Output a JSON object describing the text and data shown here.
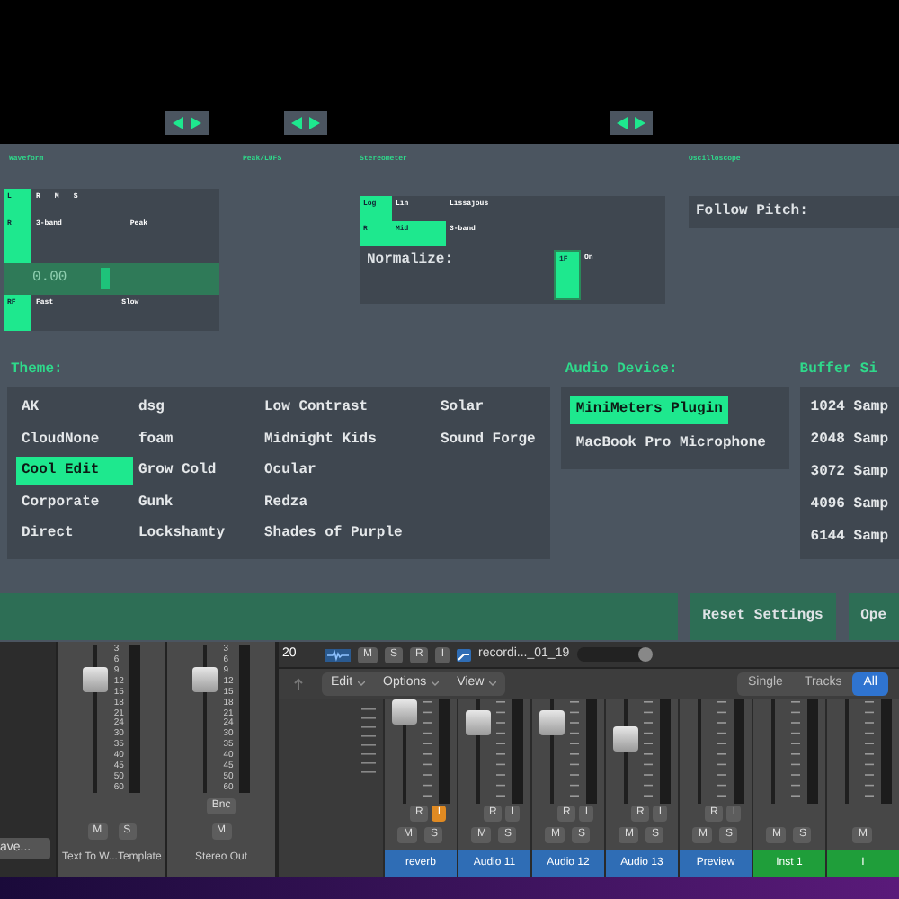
{
  "meters": {
    "waveform": {
      "title": "Waveform",
      "rows": [
        {
          "key": "L",
          "key_selected": true,
          "options": [
            "R",
            "M",
            "S"
          ]
        },
        {
          "key": "R",
          "key_selected": true,
          "options": [
            "3-band",
            "Peak"
          ]
        },
        {
          "key": "RF",
          "key_selected": true,
          "options": [
            "Fast",
            "Slow"
          ]
        }
      ],
      "slider": {
        "reading": "0.00",
        "level": 0.45
      }
    },
    "peak_lufs": {
      "title": "Peak/LUFS"
    },
    "stereometer": {
      "title": "Stereometer",
      "rows": [
        {
          "options": [
            {
              "label": "Log",
              "selected": true
            },
            {
              "label": "Lin",
              "selected": false
            },
            {
              "label": "Lissajous",
              "selected": false
            }
          ]
        },
        {
          "options": [
            {
              "label": "R",
              "selected": true
            },
            {
              "label": "Mid",
              "selected": true
            },
            {
              "label": "3-band",
              "selected": false
            }
          ]
        }
      ],
      "normalize": {
        "label": "Normalize:",
        "options": [
          {
            "label": "1F",
            "selected": true
          },
          {
            "label": "On",
            "selected": false
          }
        ]
      }
    },
    "oscilloscope": {
      "title": "Oscilloscope",
      "follow_pitch": "Follow Pitch:"
    }
  },
  "theme": {
    "title": "Theme:",
    "items": [
      {
        "label": "AK",
        "selected": false
      },
      {
        "label": "CloudNone",
        "selected": false
      },
      {
        "label": "Cool Edit",
        "selected": true
      },
      {
        "label": "Corporate",
        "selected": false
      },
      {
        "label": "Direct",
        "selected": false
      },
      {
        "label": "dsg",
        "selected": false
      },
      {
        "label": "foam",
        "selected": false
      },
      {
        "label": "Grow Cold",
        "selected": false
      },
      {
        "label": "Gunk",
        "selected": false
      },
      {
        "label": "Lockshamty",
        "selected": false
      },
      {
        "label": "Low Contrast",
        "selected": false
      },
      {
        "label": "Midnight Kids",
        "selected": false
      },
      {
        "label": "Ocular",
        "selected": false
      },
      {
        "label": "Redza",
        "selected": false
      },
      {
        "label": "Shades of Purple",
        "selected": false
      },
      {
        "label": "Solar",
        "selected": false
      },
      {
        "label": "Sound Forge",
        "selected": false
      }
    ]
  },
  "audio_device": {
    "title": "Audio Device:",
    "items": [
      {
        "label": "MiniMeters Plugin",
        "selected": true
      },
      {
        "label": "MacBook Pro Microphone",
        "selected": false
      }
    ]
  },
  "buffer_size": {
    "title": "Buffer Si",
    "items": [
      {
        "label": "1024 Samp",
        "selected": false
      },
      {
        "label": "2048 Samp",
        "selected": false
      },
      {
        "label": "3072 Samp",
        "selected": false
      },
      {
        "label": "4096 Samp",
        "selected": false
      },
      {
        "label": "6144 Samp",
        "selected": false
      }
    ]
  },
  "buttons": [
    "Reset Settings",
    "Ope"
  ],
  "mixer": {
    "save_button": "ave...",
    "left_strips": [
      {
        "name": "Text To W...Template",
        "buttons": [
          "M",
          "S"
        ],
        "level": 0.85,
        "scale": [
          "3",
          "6",
          "9",
          "12",
          "15",
          "18",
          "21",
          "24",
          "30",
          "35",
          "40",
          "45",
          "50",
          "60"
        ]
      },
      {
        "name": "Stereo Out",
        "buttons": [
          "M"
        ],
        "bounce": "Bnc",
        "level": 0.85,
        "scale": [
          "3",
          "6",
          "9",
          "12",
          "15",
          "18",
          "21",
          "24",
          "30",
          "35",
          "40",
          "45",
          "50",
          "60"
        ]
      }
    ],
    "track": {
      "number": "20",
      "buttons": [
        "M",
        "S",
        "R",
        "I"
      ],
      "region": "recordi..._01_19"
    },
    "toolbar": {
      "menus": [
        "Edit",
        "Options",
        "View"
      ],
      "views": [
        {
          "label": "Single",
          "selected": false
        },
        {
          "label": "Tracks",
          "selected": false
        },
        {
          "label": "All",
          "selected": true
        }
      ]
    },
    "strips": [
      {
        "name": "reverb",
        "color": "#2f6db5",
        "arm": [
          "R",
          "I"
        ],
        "input_on": true,
        "buttons": [
          "M",
          "S"
        ],
        "level": 1.0
      },
      {
        "name": "Audio 11",
        "color": "#2f6db5",
        "arm": [
          "R",
          "I"
        ],
        "input_on": false,
        "buttons": [
          "M",
          "S"
        ],
        "level": 0.9
      },
      {
        "name": "Audio 12",
        "color": "#2f6db5",
        "arm": [
          "R",
          "I"
        ],
        "input_on": false,
        "buttons": [
          "M",
          "S"
        ],
        "level": 0.9
      },
      {
        "name": "Audio 13",
        "color": "#2f6db5",
        "arm": [
          "R",
          "I"
        ],
        "input_on": false,
        "buttons": [
          "M",
          "S"
        ],
        "level": 0.75
      },
      {
        "name": "Preview",
        "color": "#2f6db5",
        "arm": [
          "R",
          "I"
        ],
        "input_on": false,
        "buttons": [
          "M",
          "S"
        ]
      },
      {
        "name": "Inst 1",
        "color": "#1f9e3a",
        "buttons": [
          "M",
          "S"
        ]
      },
      {
        "name": "I",
        "color": "#1f9e3a",
        "buttons": [
          "M"
        ]
      }
    ]
  }
}
